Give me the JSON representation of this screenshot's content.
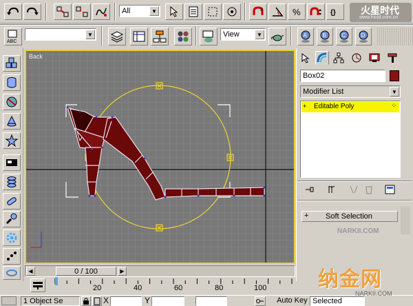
{
  "toolbar": {
    "selection_filter": "All",
    "named_selection": "",
    "view_mode": "View"
  },
  "viewport": {
    "label": "Back",
    "bg_color": "#777777",
    "grid_color": "#8c8c8c",
    "axis_color": "#000000",
    "gizmo_color": "#e8d038",
    "mesh_color": "#6b0808",
    "edge_color": "#e0d8f0"
  },
  "command_panel": {
    "tabs": [
      "create-tab",
      "modify-tab",
      "hierarchy-tab",
      "motion-tab",
      "display-tab",
      "utilities-tab"
    ],
    "object_name": "Box02",
    "object_color": "#8b0f0f",
    "modifier_list_label": "Modifier List",
    "stack": [
      {
        "label": "Editable Poly",
        "selected": true
      }
    ],
    "stack_highlight_color": "#f8f400",
    "rollout_title": "Soft Selection"
  },
  "timeline": {
    "frame_display": "0 / 100",
    "ticks": [
      "20",
      "40",
      "60",
      "80",
      "100"
    ]
  },
  "status_bar": {
    "selection_info": "1 Object Se",
    "x_label": "X",
    "y_label": "Y",
    "auto_key_label": "Auto Key",
    "selected_label": "Selected"
  },
  "watermarks": {
    "top_right": "火星时代",
    "top_right_url": "www.hxsd.com.cn",
    "bottom_right": "纳金网",
    "bottom_url": "NARKII.COM"
  }
}
